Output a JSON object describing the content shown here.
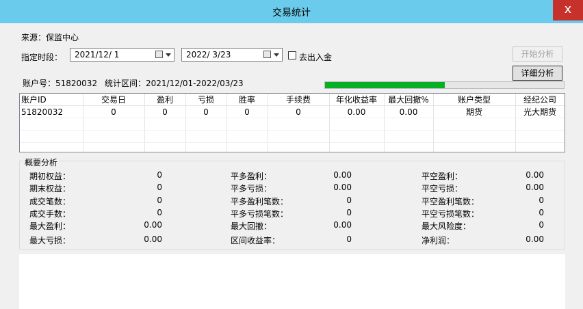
{
  "window": {
    "title": "交易统计",
    "close": "x"
  },
  "source_text": "来源：保监中心",
  "period_label": "指定时段：",
  "start_date": "2021/12/  1",
  "end_date": "2022/  3/23",
  "checkbox_label": "去出入金",
  "btn_start": "开始分析",
  "btn_detail": "详细分析",
  "account_label": "账户号：51820032",
  "range_label": "统计区间：2021/12/01-2022/03/23",
  "progress_fraction": 0.5,
  "table": {
    "headers": [
      "账户ID",
      "交易日",
      "盈利",
      "亏损",
      "胜率",
      "手续费",
      "年化收益率",
      "最大回撤%",
      "账户类型",
      "经纪公司"
    ],
    "rows": [
      [
        "51820032",
        "0",
        "0",
        "0",
        "0",
        "0",
        "0.00",
        "0.00",
        "期货",
        "光大期货"
      ]
    ]
  },
  "summary": {
    "title": "概要分析",
    "col1": [
      {
        "label": "期初权益：",
        "value": "0"
      },
      {
        "label": "期末权益：",
        "value": "0"
      },
      {
        "label": "成交笔数：",
        "value": "0"
      },
      {
        "label": "成交手数：",
        "value": "0"
      },
      {
        "label": "最大盈利：",
        "value": "0.00"
      },
      {
        "label": "最大亏损：",
        "value": "0.00"
      }
    ],
    "col2": [
      {
        "label": "平多盈利：",
        "value": "0.00"
      },
      {
        "label": "平多亏损：",
        "value": "0.00"
      },
      {
        "label": "平多盈利笔数：",
        "value": "0"
      },
      {
        "label": "平多亏损笔数：",
        "value": "0"
      },
      {
        "label": "最大回撤：",
        "value": "0.00"
      },
      {
        "label": "区间收益率：",
        "value": "0"
      }
    ],
    "col3": [
      {
        "label": "平空盈利：",
        "value": "0.00"
      },
      {
        "label": "平空亏损：",
        "value": "0.00"
      },
      {
        "label": "平空盈利笔数：",
        "value": "0"
      },
      {
        "label": "平空亏损笔数：",
        "value": "0"
      },
      {
        "label": "最大风险度：",
        "value": "0"
      },
      {
        "label": "净利润：",
        "value": "0.00"
      }
    ]
  }
}
